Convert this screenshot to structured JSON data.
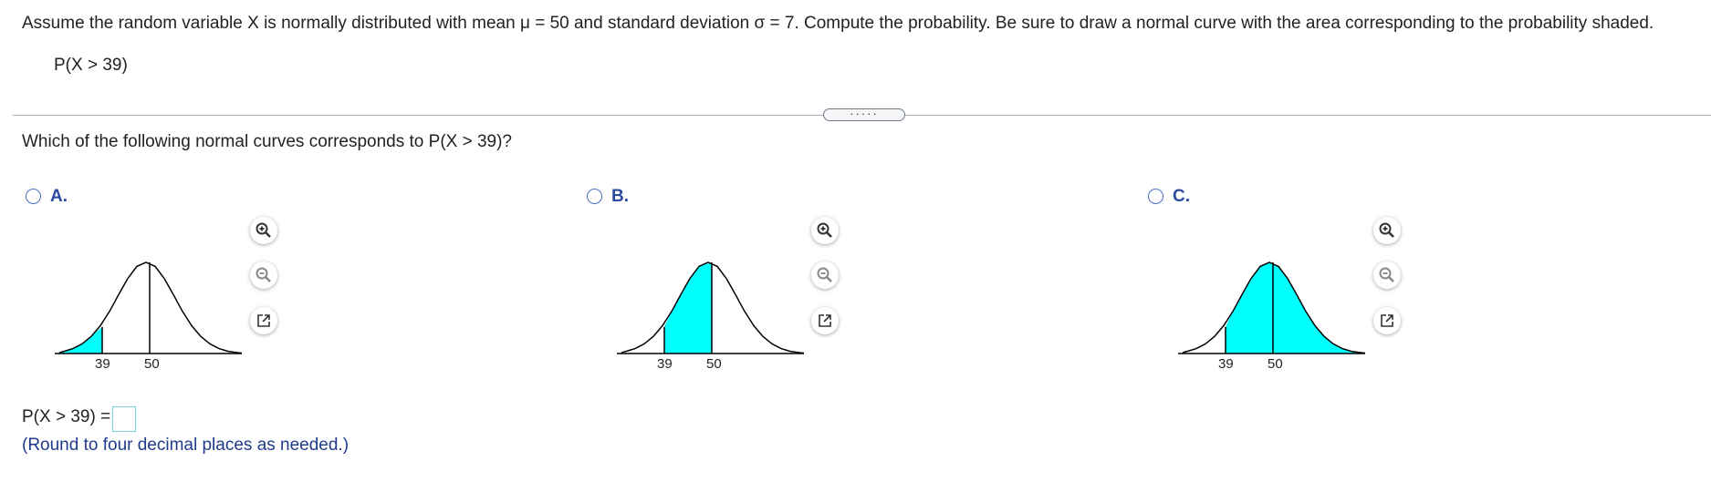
{
  "question": "Assume the random variable X is normally distributed with mean μ = 50 and standard deviation σ = 7. Compute the probability. Be sure to draw a normal curve with the area corresponding to the probability shaded.",
  "expression": "P(X > 39)",
  "expand_label": "·····",
  "sub_question": "Which of the following normal curves corresponds to P(X > 39)?",
  "options": [
    {
      "label": "A.",
      "tick_left": "39",
      "tick_mean": "50",
      "shading": "left-of-39"
    },
    {
      "label": "B.",
      "tick_left": "39",
      "tick_mean": "50",
      "shading": "between-39-and-50"
    },
    {
      "label": "C.",
      "tick_left": "39",
      "tick_mean": "50",
      "shading": "right-of-39"
    }
  ],
  "tools": [
    "zoom-in-icon",
    "zoom-out-icon",
    "popout-icon"
  ],
  "answer": {
    "label": "P(X > 39) =",
    "value": "",
    "hint": "(Round to four decimal places as needed.)"
  },
  "colors": {
    "shade": "#00ffff",
    "option_label": "#2c4aa0",
    "hint": "#1f3b8a"
  }
}
